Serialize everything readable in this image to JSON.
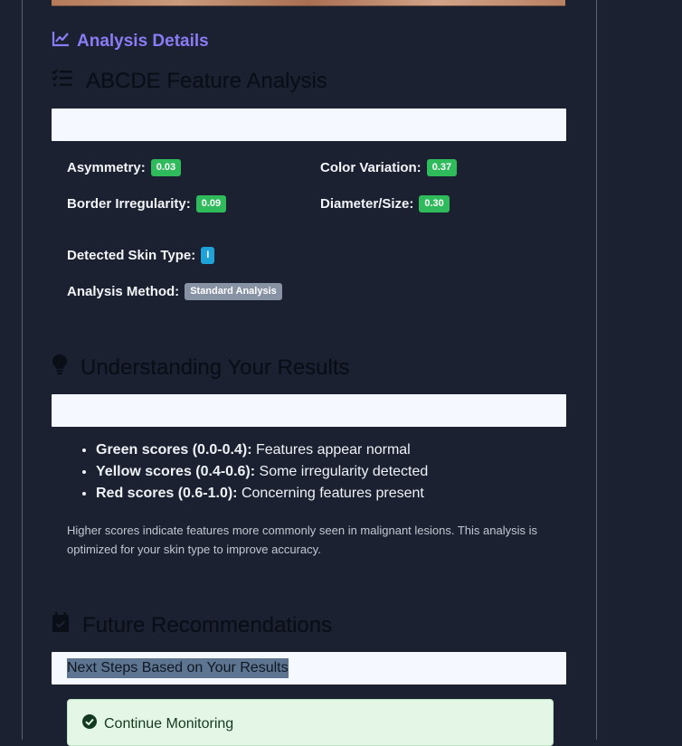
{
  "analysis_details": {
    "label": "Analysis Details"
  },
  "abcde": {
    "title": "ABCDE Feature Analysis",
    "features": [
      {
        "label": "Asymmetry:",
        "value": "0.03"
      },
      {
        "label": "Color Variation:",
        "value": "0.37"
      },
      {
        "label": "Border Irregularity:",
        "value": "0.09"
      },
      {
        "label": "Diameter/Size:",
        "value": "0.30"
      }
    ],
    "skin_type": {
      "label": "Detected Skin Type:",
      "value": "I"
    },
    "method": {
      "label": "Analysis Method:",
      "value": "Standard Analysis"
    }
  },
  "understanding": {
    "title": "Understanding Your Results",
    "items": [
      {
        "bold": "Green scores (0.0-0.4):",
        "text": " Features appear normal"
      },
      {
        "bold": "Yellow scores (0.4-0.6):",
        "text": " Some irregularity detected"
      },
      {
        "bold": "Red scores (0.6-1.0):",
        "text": " Concerning features present"
      }
    ],
    "note": "Higher scores indicate features more commonly seen in malignant lesions. This analysis is optimized for your skin type to improve accuracy."
  },
  "future": {
    "title": "Future Recommendations",
    "next_steps": "Next Steps Based on Your Results",
    "alert": "Continue Monitoring"
  },
  "colors": {
    "accent": "#8b7cf6",
    "badge_green": "#2fba5c",
    "badge_blue": "#1fa2d8",
    "badge_gray": "#8792a5",
    "background": "#1b2130"
  }
}
